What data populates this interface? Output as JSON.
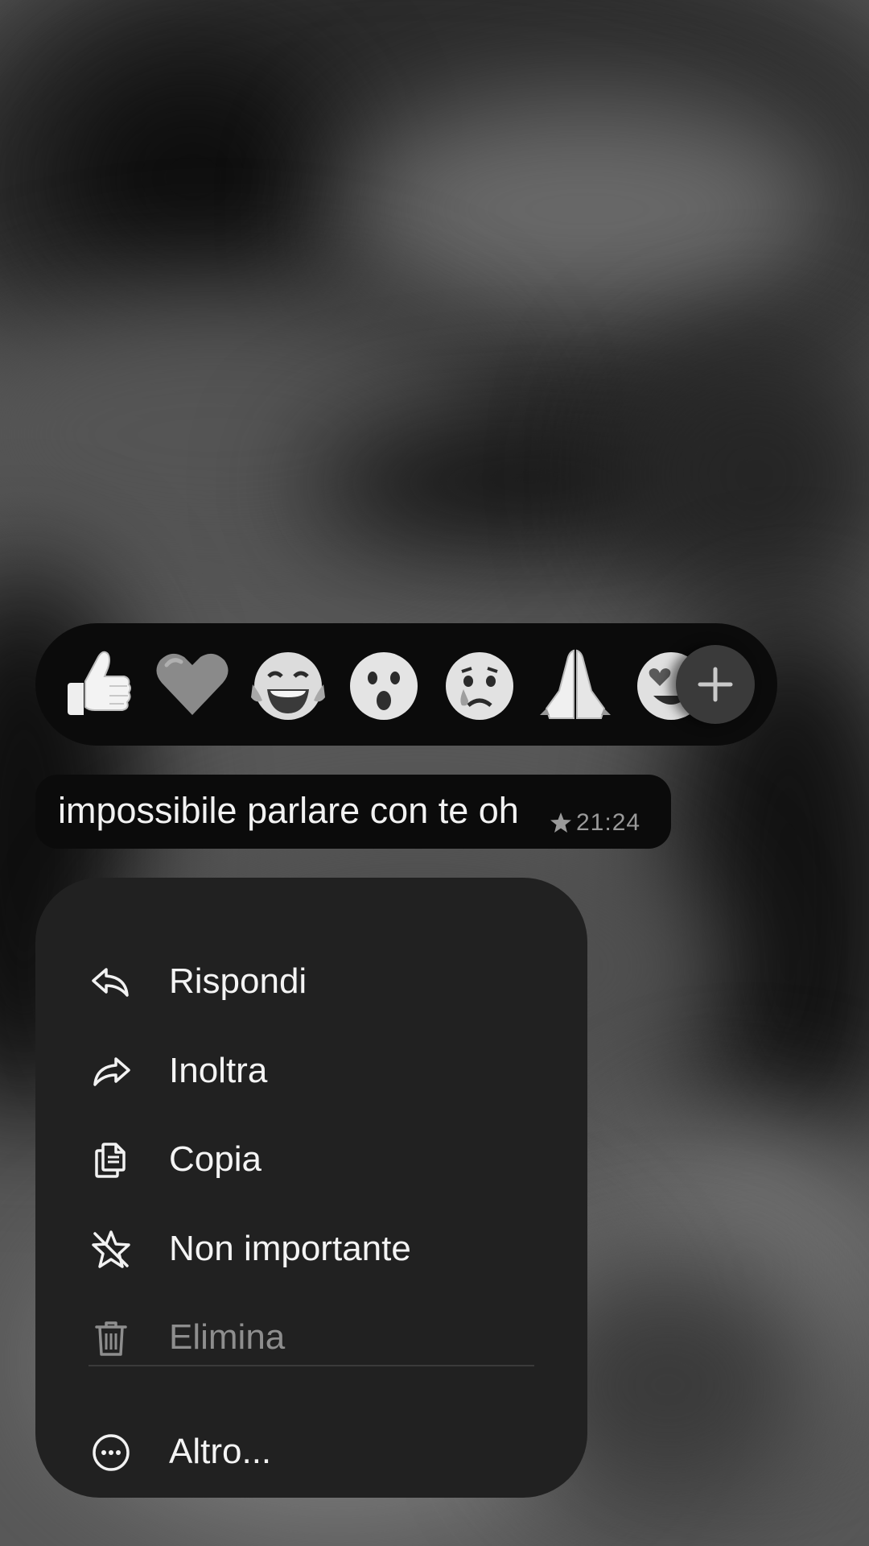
{
  "reactions": {
    "emojis": [
      "thumbs-up",
      "heart",
      "tears-of-joy",
      "surprised",
      "crying",
      "folded-hands",
      "heart-eyes"
    ],
    "add_icon": "plus-icon"
  },
  "message": {
    "text": "impossibile parlare con te oh",
    "starred_icon": "star-icon",
    "time": "21:24"
  },
  "menu": {
    "items": [
      {
        "label": "Rispondi",
        "icon": "reply-icon"
      },
      {
        "label": "Inoltra",
        "icon": "forward-icon"
      },
      {
        "label": "Copia",
        "icon": "copy-icon"
      },
      {
        "label": "Non importante",
        "icon": "unstar-icon"
      },
      {
        "label": "Elimina",
        "icon": "trash-icon"
      },
      {
        "label": "Altro...",
        "icon": "more-icon"
      }
    ]
  }
}
